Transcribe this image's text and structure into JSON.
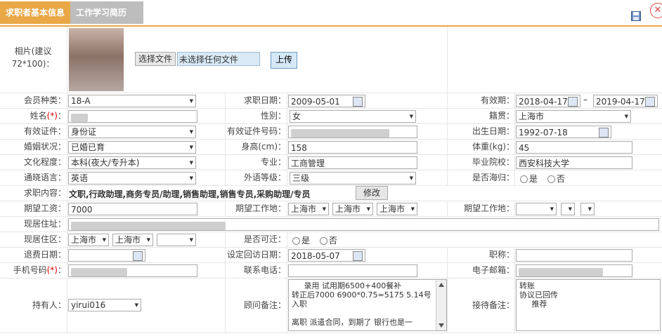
{
  "tabs": [
    {
      "label": "求职者基本信息"
    },
    {
      "label": "工作学习简历"
    }
  ],
  "icons": {
    "save": "save-icon",
    "close": "close-icon"
  },
  "photo": {
    "label": "相片(建议72*100)：",
    "choose_btn": "选择文件",
    "file_text": "未选择任何文件",
    "upload_btn": "上传"
  },
  "member_type": {
    "label": "会员种类：",
    "value": "18-A"
  },
  "apply_date": {
    "label": "求职日期：",
    "value": "2009-05-01"
  },
  "valid_period": {
    "label": "有效期：",
    "from": "2018-04-17",
    "sep": "–",
    "to": "2019-04-17"
  },
  "name": {
    "label": "姓名",
    "req": "(*)",
    "colon": "："
  },
  "gender": {
    "label": "性别：",
    "value": "女"
  },
  "origin": {
    "label": "籍贯：",
    "value": "上海市"
  },
  "id_type": {
    "label": "有效证件：",
    "value": "身份证"
  },
  "id_no": {
    "label": "有效证件号码："
  },
  "birth": {
    "label": "出生日期：",
    "value": "1992-07-18"
  },
  "marriage": {
    "label": "婚姻状况：",
    "value": "已婚已育"
  },
  "height": {
    "label": "身高(cm)：",
    "value": "158"
  },
  "weight": {
    "label": "体重(kg)：",
    "value": "45"
  },
  "education": {
    "label": "文化程度：",
    "value": "本科(夜大/专升本)"
  },
  "major": {
    "label": "专业：",
    "value": "工商管理"
  },
  "school": {
    "label": "毕业院校：",
    "value": "西安科技大学"
  },
  "language": {
    "label": "通晓语言：",
    "value": "英语"
  },
  "lang_level": {
    "label": "外语等级：",
    "value": "三级"
  },
  "returnee": {
    "label": "是否海归：",
    "yes": "是",
    "no": "否"
  },
  "job_content": {
    "label": "求职内容：",
    "value": "文职,行政助理,商务专员/助理,销售助理,销售专员,采购助理/专员",
    "edit_btn": "修改"
  },
  "salary": {
    "label": "期望工资：",
    "value": "7000"
  },
  "work_place1": {
    "label": "期望工作地：",
    "s1": "上海市",
    "s2": "上海市",
    "s3": "上海市"
  },
  "work_place2": {
    "label": "期望工作地："
  },
  "address": {
    "label": "现居住址："
  },
  "current_area": {
    "label": "现居住区：",
    "s1": "上海市",
    "s2": "上海市"
  },
  "relocate": {
    "label": "是否可迁：",
    "yes": "是",
    "no": "否"
  },
  "refund_date": {
    "label": "退费日期："
  },
  "visit_date": {
    "label": "设定回访日期：",
    "value": "2018-05-07"
  },
  "title": {
    "label": "职称："
  },
  "mobile": {
    "label": "手机号码",
    "req": "(*)",
    "colon": "："
  },
  "phone": {
    "label": "联系电话："
  },
  "email": {
    "label": "电子邮箱："
  },
  "holder": {
    "label": "持有人：",
    "value": "yirui016"
  },
  "advisor_note": {
    "label": "顾问备注：",
    "value": "     录用 试用期6500+400餐补\n转正后7000 6900*0.75=5175 5.14号入职\n\n离职 派遣合同，到期了 银行也是一"
  },
  "reception_note": {
    "label": "接待备注：",
    "value": "转账\n协议已回传\n     推荐"
  }
}
